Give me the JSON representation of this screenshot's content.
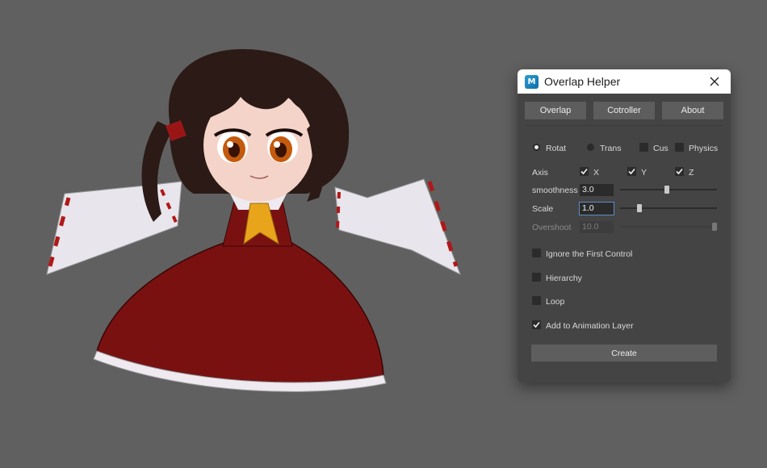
{
  "window": {
    "title": "Overlap Helper",
    "app_icon_label": "M"
  },
  "tabs": [
    {
      "label": "Overlap"
    },
    {
      "label": "Cotroller"
    },
    {
      "label": "About"
    }
  ],
  "mode_radios": [
    {
      "label": "Rotat",
      "selected": true
    },
    {
      "label": "Trans",
      "selected": false
    }
  ],
  "mode_checks": [
    {
      "label": "Cus",
      "checked": false
    },
    {
      "label": "Physics",
      "checked": false
    }
  ],
  "axis": {
    "label": "Axis",
    "options": [
      {
        "label": "X",
        "checked": true
      },
      {
        "label": "Y",
        "checked": true
      },
      {
        "label": "Z",
        "checked": true
      }
    ]
  },
  "smoothness": {
    "label": "smoothness",
    "value": "3.0",
    "slider_fraction": 0.48
  },
  "scale": {
    "label": "Scale",
    "value": "1.0",
    "slider_fraction": 0.18
  },
  "overshoot": {
    "label": "Overshoot",
    "value": "10.0",
    "enabled": false,
    "slider_fraction": 1.0
  },
  "options": [
    {
      "label": "Ignore the First Control",
      "checked": false
    },
    {
      "label": "Hierarchy",
      "checked": false
    },
    {
      "label": "Loop",
      "checked": false
    },
    {
      "label": "Add to Animation Layer",
      "checked": true
    }
  ],
  "create_label": "Create",
  "colors": {
    "viewport_bg": "#606060",
    "dialog_bg": "#444444",
    "dress_red": "#7a1111",
    "bow_yellow": "#e8a51c"
  }
}
